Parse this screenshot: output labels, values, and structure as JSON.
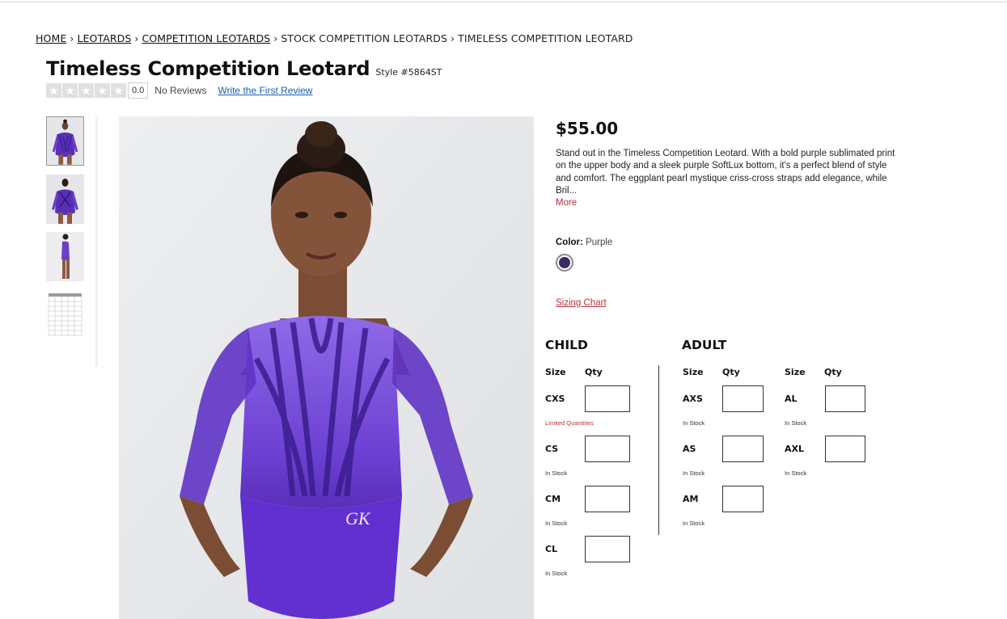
{
  "breadcrumb": {
    "items": [
      "HOME",
      "LEOTARDS",
      "COMPETITION LEOTARDS",
      "STOCK COMPETITION LEOTARDS",
      "TIMELESS COMPETITION LEOTARD"
    ],
    "separator": "›"
  },
  "product": {
    "title": "Timeless Competition Leotard",
    "style_no": "Style #5864ST",
    "rating": "0.0",
    "reviews_text": "No Reviews",
    "write_review": "Write the First Review",
    "price": "$55.00",
    "description": "Stand out in the Timeless Competition Leotard. With a bold purple sublimated print on the upper body and a sleek purple SoftLux bottom, it's a perfect blend of style and comfort. The eggplant pearl mystique criss-cross straps add elegance, while Bril...",
    "more": "More",
    "color_label": "Color:",
    "color_value": "Purple",
    "swatch_color": "#3b2b66",
    "sizing_chart": "Sizing Chart"
  },
  "sizes": {
    "child_title": "CHILD",
    "adult_title": "ADULT",
    "size_head": "Size",
    "qty_head": "Qty",
    "child": [
      {
        "size": "CXS",
        "status": "Limited Quantities"
      },
      {
        "size": "CS",
        "status": "In Stock"
      },
      {
        "size": "CM",
        "status": "In Stock"
      },
      {
        "size": "CL",
        "status": "In Stock"
      }
    ],
    "adult_col1": [
      {
        "size": "AXS",
        "status": "In Stock"
      },
      {
        "size": "AS",
        "status": "In Stock"
      },
      {
        "size": "AM",
        "status": "In Stock"
      }
    ],
    "adult_col2": [
      {
        "size": "AL",
        "status": "In Stock"
      },
      {
        "size": "AXL",
        "status": "In Stock"
      }
    ]
  },
  "colors": {
    "accent": "#b5323c",
    "link": "#1a5fb4",
    "leotard": "#5a2fb8"
  }
}
